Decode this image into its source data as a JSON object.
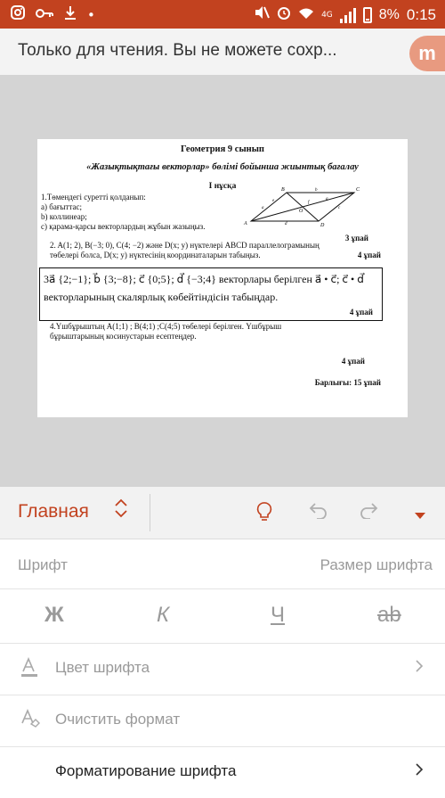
{
  "status_bar": {
    "time": "0:15",
    "battery": "8%",
    "network": "4G",
    "icons_left": [
      "instagram-icon",
      "key-icon",
      "download-icon",
      "dots-icon"
    ],
    "icons_right": [
      "mute-icon",
      "alarm-icon",
      "wifi-icon",
      "signal-icon",
      "battery-icon"
    ]
  },
  "title_bar": {
    "message": "Только для чтения. Вы не можете сохр...",
    "brand_letter": "m"
  },
  "document": {
    "title": "Геометрия 9 сынып",
    "subtitle": "«Жазықтықтағы векторлар» бөлімі бойынша жиынтық бағалау",
    "variant": "I нұсқа",
    "q1_intro": "1.Төмендегі суретті қолданып:",
    "q1_a": "а) бағыттас;",
    "q1_b": "b) коллинеар;",
    "q1_c": "с) қарама-қарсы векторлардың жұбын жазыңыз.",
    "q1_points": "3 ұпай",
    "q2_line1": "2. A(1; 2), B(−3; 0), C(4; −2) және D(x; y) нүктелері ABCD параллелограмының",
    "q2_line2": "төбелері болса, D(x; y) нүктесінің координаталарын табыңыз.",
    "q2_points": "4 ұпай",
    "q3_line1": "3a⃗ {2;−1}; b⃗ {3;−8}; c⃗ {0;5}; d⃗ {−3;4}  векторлары берілген  a⃗ • c⃗; c⃗ • d⃗",
    "q3_line2": "векторларының скалярлық көбейтіндісін табыңдар.",
    "q3_points": "4 ұпай",
    "q4_line1": "4.Үшбұрыштың A(1;1) ; B(4;1) ;C(4;5) төбелері берілген. Үшбұрыш",
    "q4_line2": "бұрыштарының косинустарын есептеңдер.",
    "q4_points": "4 ұпай",
    "total": "Барлығы: 15 ұпай",
    "figure_labels": [
      "A",
      "B",
      "C",
      "D",
      "O",
      "a⃗",
      "b⃗",
      "c⃗",
      "d⃗",
      "e⃗",
      "f⃗",
      "g⃗"
    ]
  },
  "ribbon": {
    "tab_label": "Главная",
    "icons": [
      "lightbulb-icon",
      "undo-icon",
      "redo-icon",
      "dropdown-icon"
    ]
  },
  "panel": {
    "font_label": "Шрифт",
    "font_size_label": "Размер шрифта",
    "bold": "Ж",
    "italic": "К",
    "underline": "Ч",
    "strike": "ab",
    "font_color": "Цвет шрифта",
    "clear_format": "Очистить формат",
    "format_font": "Форматирование шрифта"
  },
  "colors": {
    "accent": "#c2421f",
    "canvas_bg": "#d4d4d4"
  }
}
